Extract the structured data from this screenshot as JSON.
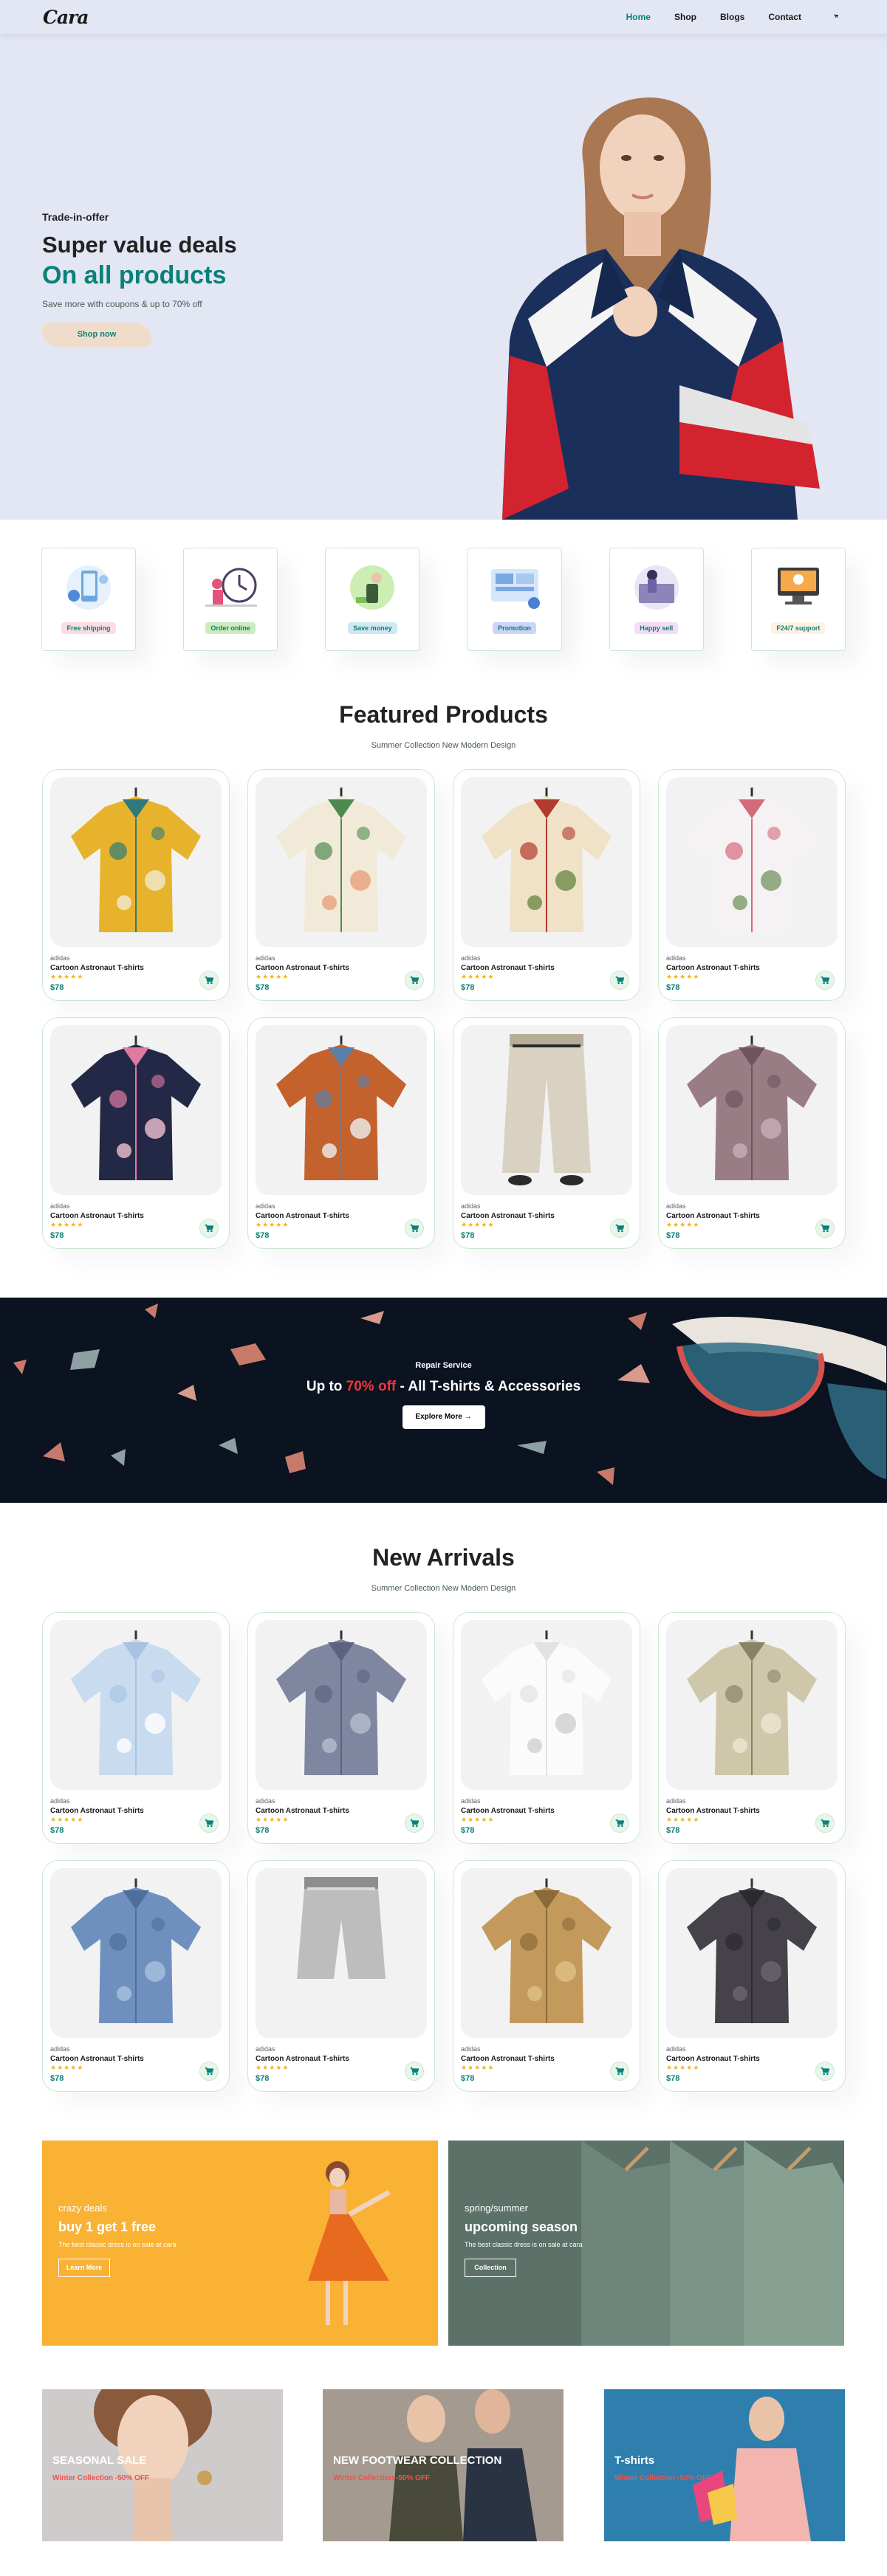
{
  "header": {
    "logo": "Cara",
    "nav": [
      {
        "label": "Home",
        "active": true
      },
      {
        "label": "Shop",
        "active": false
      },
      {
        "label": "Blogs",
        "active": false
      },
      {
        "label": "Contact",
        "active": false
      }
    ],
    "cart_icon": "cart-icon"
  },
  "hero": {
    "eyebrow": "Trade-in-offer",
    "heading": "Super value deals",
    "highlight": "On all products",
    "text": "Save more with coupons & up to 70% off",
    "button": "Shop now"
  },
  "features": [
    {
      "label": "Free shipping",
      "bg": "#fddde4",
      "icon": "free-shipping-icon"
    },
    {
      "label": "Order online",
      "bg": "#cdebbc",
      "icon": "order-online-icon"
    },
    {
      "label": "Save money",
      "bg": "#d1e8f2",
      "icon": "save-money-icon"
    },
    {
      "label": "Promotion",
      "bg": "#cdd4f8",
      "icon": "promotion-icon"
    },
    {
      "label": "Happy sell",
      "bg": "#f6dbf6",
      "icon": "happy-sell-icon"
    },
    {
      "label": "F24/7 support",
      "bg": "#fff2e5",
      "icon": "support-icon"
    }
  ],
  "featured": {
    "title": "Featured Products",
    "subtitle": "Summer Collection New Modern Design",
    "products": [
      {
        "brand": "adidas",
        "name": "Cartoon Astronaut T-shirts",
        "rating": 5,
        "price": "$78",
        "image": "shirt-abstract-print"
      },
      {
        "brand": "adidas",
        "name": "Cartoon Astronaut T-shirts",
        "rating": 5,
        "price": "$78",
        "image": "shirt-palm-leaf"
      },
      {
        "brand": "adidas",
        "name": "Cartoon Astronaut T-shirts",
        "rating": 5,
        "price": "$78",
        "image": "shirt-red-floral"
      },
      {
        "brand": "adidas",
        "name": "Cartoon Astronaut T-shirts",
        "rating": 5,
        "price": "$78",
        "image": "shirt-pink-floral"
      },
      {
        "brand": "adidas",
        "name": "Cartoon Astronaut T-shirts",
        "rating": 5,
        "price": "$78",
        "image": "shirt-navy-floral"
      },
      {
        "brand": "adidas",
        "name": "Cartoon Astronaut T-shirts",
        "rating": 5,
        "price": "$78",
        "image": "jacket-orange-denim"
      },
      {
        "brand": "adidas",
        "name": "Cartoon Astronaut T-shirts",
        "rating": 5,
        "price": "$78",
        "image": "trousers-beige"
      },
      {
        "brand": "adidas",
        "name": "Cartoon Astronaut T-shirts",
        "rating": 5,
        "price": "$78",
        "image": "blouse-mauve"
      }
    ]
  },
  "banner": {
    "eyebrow": "Repair Service",
    "heading_pre": "Up to ",
    "heading_hl": "70% off",
    "heading_post": " - All T-shirts & Accessories",
    "button": "Explore More →"
  },
  "arrivals": {
    "title": "New Arrivals",
    "subtitle": "Summer Collection New Modern Design",
    "products": [
      {
        "brand": "adidas",
        "name": "Cartoon Astronaut T-shirts",
        "rating": 5,
        "price": "$78",
        "image": "shirt-light-blue"
      },
      {
        "brand": "adidas",
        "name": "Cartoon Astronaut T-shirts",
        "rating": 5,
        "price": "$78",
        "image": "shirt-grey-check"
      },
      {
        "brand": "adidas",
        "name": "Cartoon Astronaut T-shirts",
        "rating": 5,
        "price": "$78",
        "image": "shirt-white"
      },
      {
        "brand": "adidas",
        "name": "Cartoon Astronaut T-shirts",
        "rating": 5,
        "price": "$78",
        "image": "shirt-beige-print"
      },
      {
        "brand": "adidas",
        "name": "Cartoon Astronaut T-shirts",
        "rating": 5,
        "price": "$78",
        "image": "shirt-denim"
      },
      {
        "brand": "adidas",
        "name": "Cartoon Astronaut T-shirts",
        "rating": 5,
        "price": "$78",
        "image": "shorts-grey"
      },
      {
        "brand": "adidas",
        "name": "Cartoon Astronaut T-shirts",
        "rating": 5,
        "price": "$78",
        "image": "jacket-tan"
      },
      {
        "brand": "adidas",
        "name": "Cartoon Astronaut T-shirts",
        "rating": 5,
        "price": "$78",
        "image": "shirt-charcoal"
      }
    ]
  },
  "promos": [
    {
      "eyebrow": "crazy deals",
      "heading": "buy 1 get 1 free",
      "text": "The best classic dress is on sale at cara",
      "button": "Learn More"
    },
    {
      "eyebrow": "spring/summer",
      "heading": "upcoming season",
      "text": "The best classic dress is on sale at cara",
      "button": "Collection"
    }
  ],
  "small_banners": [
    {
      "heading": "SEASONAL SALE",
      "sub": "Winter Collection -50% OFF"
    },
    {
      "heading": "NEW FOOTWEAR COLLECTION",
      "sub": "Winter Collection -50% OFF"
    },
    {
      "heading": "T-shirts",
      "sub": "Winter Collection -50% OFF"
    }
  ],
  "colors": {
    "accent": "#088178",
    "hero_bg": "#e3e6f3",
    "star": "#f3b519",
    "banner_bg": "#0b1220",
    "sale_red": "#ef3636"
  }
}
